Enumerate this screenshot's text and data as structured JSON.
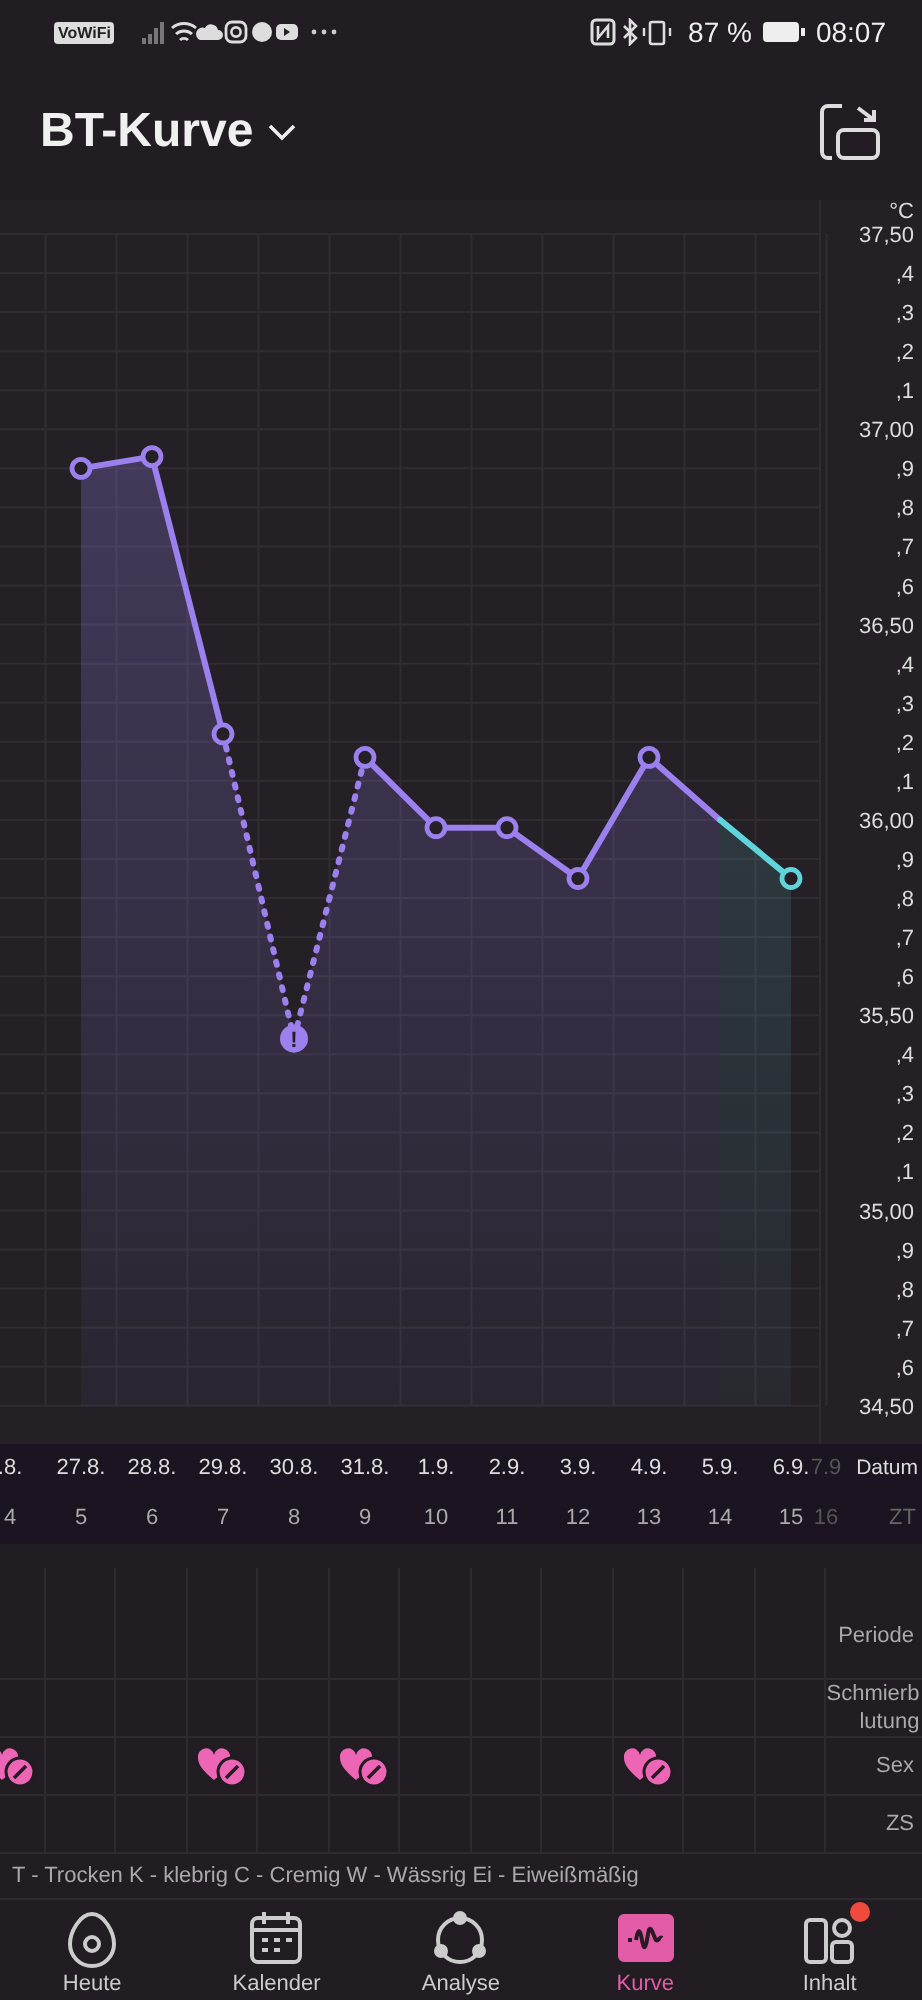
{
  "status_bar": {
    "wifi_badge": "VoWiFi",
    "battery": "87 %",
    "time": "08:07"
  },
  "header": {
    "title": "BT-Kurve"
  },
  "chart": {
    "chart_data": {
      "type": "area",
      "ylabel": "°C",
      "grid": true,
      "categories": [
        ".8.",
        "27.8.",
        "28.8.",
        "29.8.",
        "30.8.",
        "31.8.",
        "1.9.",
        "2.9.",
        "3.9.",
        "4.9.",
        "5.9.",
        "6.9.",
        "7.9"
      ],
      "series": [
        {
          "color": "#9b80ee",
          "marker": "o",
          "values": [
            null,
            36.9,
            36.93,
            36.22,
            35.44,
            36.16,
            35.98,
            35.98,
            35.85,
            36.16,
            36.0,
            null,
            null
          ]
        },
        {
          "color": "#5fd4da",
          "marker": "o",
          "values": [
            null,
            null,
            null,
            null,
            null,
            null,
            null,
            null,
            null,
            null,
            36.0,
            35.85,
            null
          ]
        }
      ],
      "ylim": [
        34.5,
        37.5
      ],
      "yticks": [
        {
          "value": 37.5,
          "label": "37,50"
        },
        {
          "value": 37.0,
          "label": "37,00"
        },
        {
          "value": 36.5,
          "label": "36,50"
        },
        {
          "value": 36.0,
          "label": "36,00"
        },
        {
          "value": 35.5,
          "label": "35,50"
        },
        {
          "value": 35.0,
          "label": "35,00"
        },
        {
          "value": 34.5,
          "label": "34,50"
        }
      ],
      "annotations": [
        {
          "x": "30.8.",
          "text": "!"
        }
      ]
    },
    "minor_tick_labels": [
      ",4",
      ",3",
      ",2",
      ",1",
      ",9",
      ",8",
      ",7",
      ",6",
      ",4",
      ",3",
      ",2",
      ",1",
      ",9",
      ",8",
      ",7",
      ",6",
      ",4",
      ",3",
      ",2",
      ",1",
      ",9",
      ",8",
      ",7",
      ",6"
    ],
    "date_label": "Datum",
    "day_label": "ZT"
  },
  "days": [
    {
      "cycle_day": "4",
      "future": false
    },
    {
      "cycle_day": "5",
      "future": false
    },
    {
      "cycle_day": "6",
      "future": false
    },
    {
      "cycle_day": "7",
      "future": false
    },
    {
      "cycle_day": "8",
      "future": false
    },
    {
      "cycle_day": "9",
      "future": false
    },
    {
      "cycle_day": "10",
      "future": false
    },
    {
      "cycle_day": "11",
      "future": false
    },
    {
      "cycle_day": "12",
      "future": false
    },
    {
      "cycle_day": "13",
      "future": false
    },
    {
      "cycle_day": "14",
      "future": false
    },
    {
      "cycle_day": "15",
      "future": false
    },
    {
      "cycle_day": "16",
      "future": true
    }
  ],
  "symptom_rows": [
    {
      "label": "Periode",
      "kind": "period"
    },
    {
      "label": "Schmierb\nlutung",
      "kind": "spotting"
    },
    {
      "label": "Sex",
      "kind": "sex",
      "cells": [
        {
          "marked": true
        },
        {
          "marked": false
        },
        {
          "marked": false
        },
        {
          "marked": true
        },
        {
          "marked": false
        },
        {
          "marked": true
        },
        {
          "marked": false
        },
        {
          "marked": false
        },
        {
          "marked": false
        },
        {
          "marked": true
        },
        {
          "marked": false
        },
        {
          "marked": false
        }
      ]
    },
    {
      "label": "ZS",
      "kind": "mucus"
    }
  ],
  "legend": "T - Trocken K - klebrig C - Cremig W - Wässrig Ei - Eiweißmäßig",
  "nav": [
    {
      "label": "Heute",
      "kind": "today",
      "selected": false,
      "badge": false
    },
    {
      "label": "Kalender",
      "kind": "calendar",
      "selected": false,
      "badge": false
    },
    {
      "label": "Analyse",
      "kind": "analysis",
      "selected": false,
      "badge": false
    },
    {
      "label": "Kurve",
      "kind": "curve",
      "selected": true,
      "badge": false
    },
    {
      "label": "Inhalt",
      "kind": "content",
      "selected": false,
      "badge": true
    }
  ]
}
